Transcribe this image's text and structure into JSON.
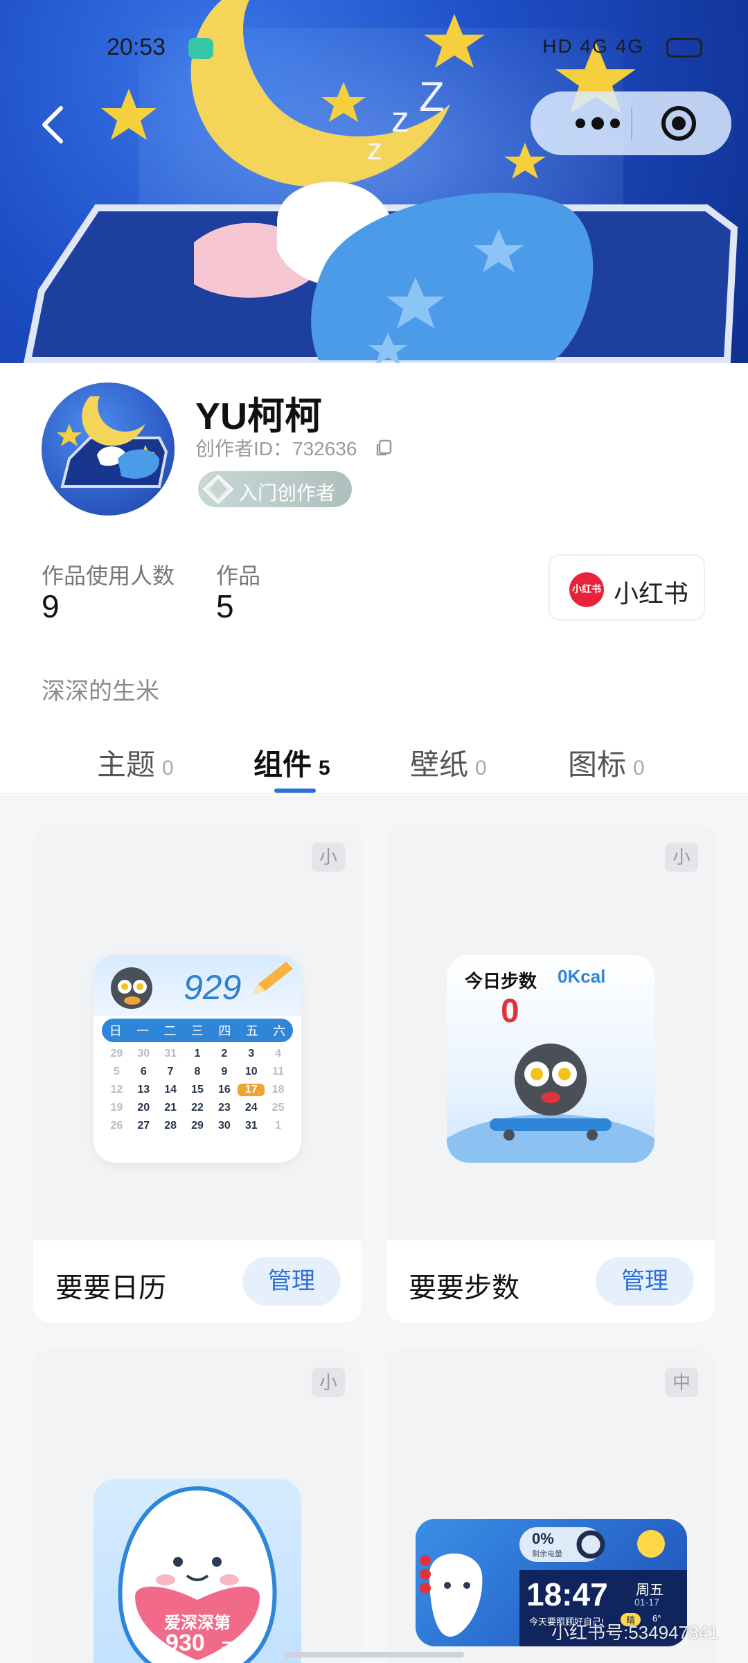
{
  "status_bar": {
    "time": "20:53",
    "right": "HD 4G 4G"
  },
  "nav": {
    "back": "back",
    "more": "more",
    "close": "close"
  },
  "profile": {
    "name": "YU柯柯",
    "creator_id": "创作者ID：732636",
    "badge": "入门创作者",
    "stats": [
      {
        "label": "作品使用人数",
        "value": "9"
      },
      {
        "label": "作品",
        "value": "5"
      }
    ],
    "xhs_button": {
      "logo": "小红书",
      "label": "小红书"
    },
    "bio": "深深的生米"
  },
  "tabs": [
    {
      "label": "主题",
      "count": "0"
    },
    {
      "label": "组件",
      "count": "5"
    },
    {
      "label": "壁纸",
      "count": "0"
    },
    {
      "label": "图标",
      "count": "0"
    }
  ],
  "cards": [
    {
      "title": "要要日历",
      "size": "小",
      "action": "管理"
    },
    {
      "title": "要要步数",
      "size": "小",
      "action": "管理"
    },
    {
      "title": "",
      "size": "小",
      "action": ""
    },
    {
      "title": "",
      "size": "中",
      "action": ""
    }
  ],
  "calendar_widget": {
    "number": "929",
    "weekdays": [
      "日",
      "一",
      "二",
      "三",
      "四",
      "五",
      "六"
    ],
    "days": [
      "29",
      "30",
      "31",
      "1",
      "2",
      "3",
      "4",
      "5",
      "6",
      "7",
      "8",
      "9",
      "10",
      "11",
      "12",
      "13",
      "14",
      "15",
      "16",
      "17",
      "18",
      "19",
      "20",
      "21",
      "22",
      "23",
      "24",
      "25",
      "26",
      "27",
      "28",
      "29",
      "30",
      "31",
      "1"
    ]
  },
  "steps_widget": {
    "label": "今日步数",
    "kcal": "0Kcal",
    "steps": "0"
  },
  "love_widget": {
    "text": "爱深深第",
    "days": "930",
    "unit": "天"
  },
  "clock_widget": {
    "percent": "0%",
    "percent_label": "剩余电量",
    "time": "18:47",
    "weekday": "周五",
    "date": "01-17",
    "note": "今天要照顾好自己!",
    "weather": "晴",
    "temp": "6°"
  },
  "watermark": "小红书号:534947841"
}
